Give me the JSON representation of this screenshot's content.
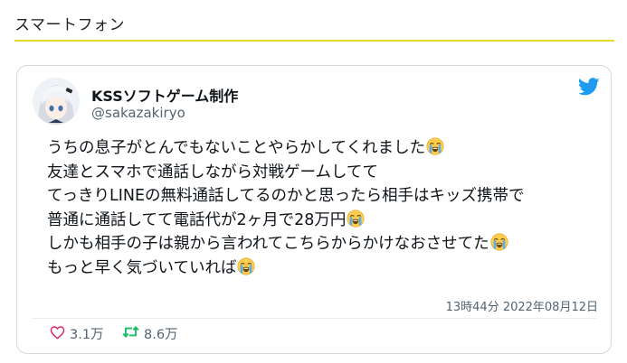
{
  "section": {
    "title": "スマートフォン"
  },
  "tweet": {
    "display_name": "KSSソフトゲーム制作",
    "handle": "@sakazakiryo",
    "lines": [
      "うちの息子がとんでもないことやらかしてくれました",
      "友達とスマホで通話しながら対戦ゲームしてて",
      "てっきりLINEの無料通話してるのかと思ったら相手はキッズ携帯で",
      "普通に通話してて電話代が2ヶ月で28万円",
      "しかも相手の子は親から言われてこちらからかけなおさせてた",
      "もっと早く気づいていれば"
    ],
    "timestamp": "13時44分 2022年08月12日",
    "likes": "3.1万",
    "retweets": "8.6万"
  },
  "colors": {
    "accent_underline": "#e8d628",
    "twitter_blue": "#1d9bf0",
    "like_red": "#e0245e",
    "retweet_green": "#17bf63"
  },
  "icons": {
    "logo": "twitter-bird-icon",
    "emoji": "loudly-crying-face-emoji",
    "like": "heart-icon",
    "retweet": "retweet-icon"
  }
}
